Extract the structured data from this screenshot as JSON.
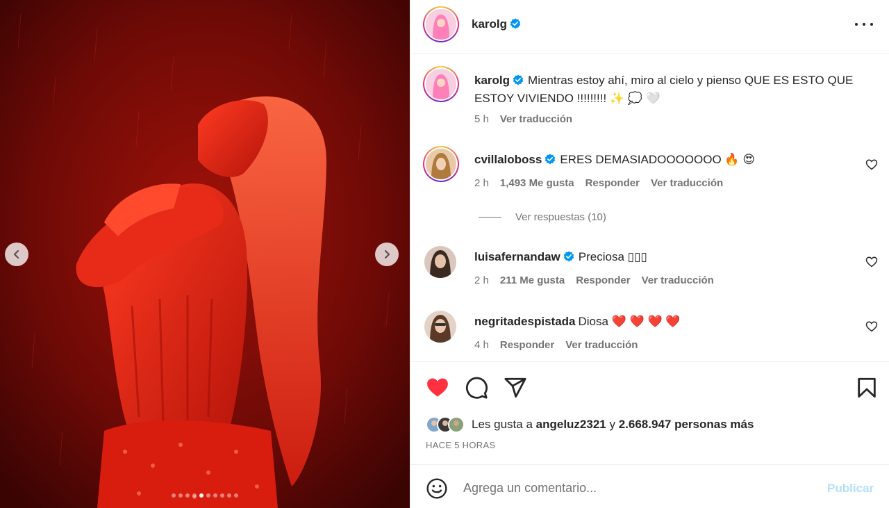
{
  "post": {
    "author": "karolg",
    "more_icon": "more-horizontal-icon"
  },
  "caption": {
    "username": "karolg",
    "text": "Mientras estoy ahí, miro al cielo y pienso QUE ES ESTO QUE ESTOY VIVIENDO !!!!!!!!! ✨ 💭 🤍",
    "time": "5 h",
    "translate": "Ver traducción"
  },
  "comments": [
    {
      "username": "cvillaloboss",
      "verified": true,
      "text": "ERES DEMASIADOOOOOOO 🔥 😍",
      "time": "2 h",
      "likes": "1,493 Me gusta",
      "reply": "Responder",
      "translate": "Ver traducción",
      "view_replies": "Ver respuestas (10)"
    },
    {
      "username": "luisafernandaw",
      "verified": true,
      "text": "Preciosa ▯▯▯",
      "time": "2 h",
      "likes": "211 Me gusta",
      "reply": "Responder",
      "translate": "Ver traducción"
    },
    {
      "username": "negritadespistada",
      "verified": false,
      "text": "Diosa ❤️ ❤️ ❤️ ❤️",
      "time": "4 h",
      "reply": "Responder",
      "translate": "Ver traducción"
    }
  ],
  "likes_summary": {
    "prefix": "Les gusta a",
    "first_liker": "angeluz2321",
    "connector": "y",
    "others": "2.668.947 personas más"
  },
  "timestamp": "HACE 5 HORAS",
  "composer": {
    "placeholder": "Agrega un comentario...",
    "publish_label": "Publicar"
  },
  "carousel": {
    "total_slides": 10,
    "active_index": 4
  },
  "colors": {
    "like_red": "#ff3040",
    "verified_blue": "#0095f6",
    "publish_disabled": "#b2dffc",
    "photo_red": "#c4160e"
  }
}
